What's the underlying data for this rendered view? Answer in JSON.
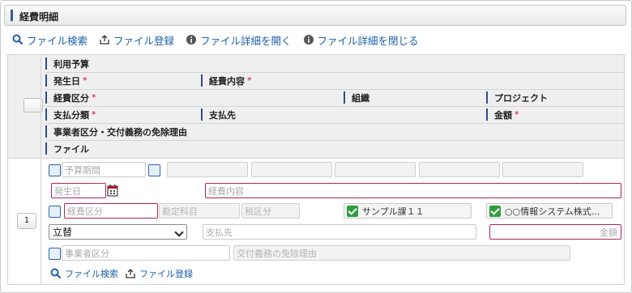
{
  "title": "経費明細",
  "toolbar": {
    "file_search": "ファイル検索",
    "file_upload": "ファイル登録",
    "open_details": "ファイル詳細を開く",
    "close_details": "ファイル詳細を閉じる"
  },
  "header": {
    "budget": "利用予算",
    "date": "発生日",
    "content": "経費内容",
    "category": "経費区分",
    "org": "組織",
    "project": "プロジェクト",
    "payment_type": "支払分類",
    "payee": "支払先",
    "amount": "金額",
    "exemption": "事業者区分・交付義務の免除理由",
    "file": "ファイル",
    "required_mark": "*"
  },
  "row": {
    "number": "1",
    "budget_period_placeholder": "予算期間",
    "date_placeholder": "発生日",
    "content_placeholder": "経費内容",
    "category_placeholder": "経費区分",
    "account_placeholder": "勘定科目",
    "tax_placeholder": "税区分",
    "org_value": "サンプル課１１",
    "project_value": "○○情報システム株式...",
    "payment_type_value": "立替",
    "payee_placeholder": "支払先",
    "amount_placeholder": "金額",
    "business_type_placeholder": "事業者区分",
    "exemption_placeholder": "交付義務の免除理由",
    "file_search": "ファイル検索",
    "file_upload": "ファイル登録"
  },
  "colors": {
    "accent": "#2e4e84",
    "link": "#1a5fa8",
    "required_border": "#b0245a",
    "check": "#2f9e3f"
  }
}
